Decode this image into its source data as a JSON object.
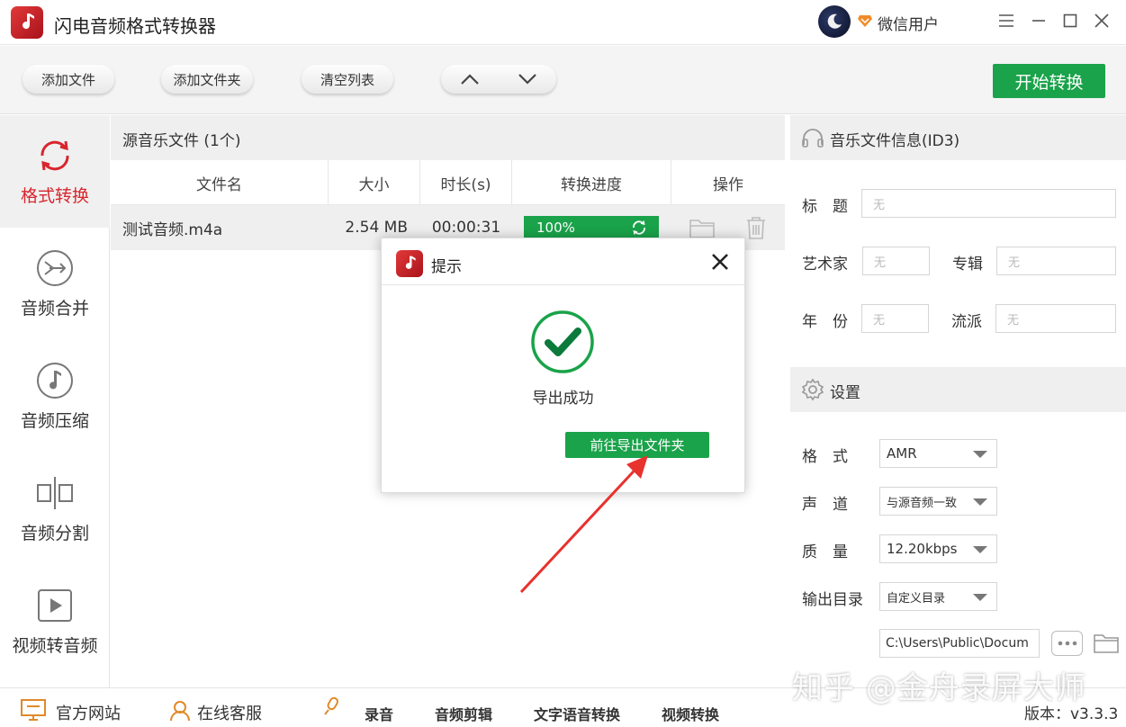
{
  "app": {
    "title": "闪电音频格式转换器",
    "user_name": "微信用户"
  },
  "toolbar": {
    "add_file": "添加文件",
    "add_folder": "添加文件夹",
    "clear_list": "清空列表",
    "start": "开始转换"
  },
  "sidebar": {
    "items": [
      {
        "label": "格式转换",
        "icon": "refresh-icon",
        "active": true
      },
      {
        "label": "音频合并",
        "icon": "merge-icon",
        "active": false
      },
      {
        "label": "音频压缩",
        "icon": "music-note-icon",
        "active": false
      },
      {
        "label": "音频分割",
        "icon": "split-icon",
        "active": false
      },
      {
        "label": "视频转音频",
        "icon": "play-icon",
        "active": false
      }
    ]
  },
  "file_list": {
    "header": "源音乐文件 (1个)",
    "columns": [
      "文件名",
      "大小",
      "时长(s)",
      "转换进度",
      "操作"
    ],
    "rows": [
      {
        "name": "测试音频.m4a",
        "size": "2.54 MB",
        "duration": "00:00:31",
        "progress": "100%"
      }
    ]
  },
  "id3": {
    "title": "音乐文件信息(ID3)",
    "title_label": "标　题",
    "artist_label": "艺术家",
    "album_label": "专辑",
    "year_label": "年　份",
    "genre_label": "流派",
    "placeholder": "无"
  },
  "settings": {
    "title": "设置",
    "format_label": "格　式",
    "format_value": "AMR",
    "channel_label": "声　道",
    "channel_value": "与源音频一致",
    "quality_label": "质　量",
    "quality_value": "12.20kbps",
    "output_label": "输出目录",
    "output_value": "自定义目录",
    "path": "C:\\Users\\Public\\Docum"
  },
  "footer": {
    "website": "官方网站",
    "support": "在线客服",
    "record": "录音",
    "audio_edit": "音频剪辑",
    "tts": "文字语音转换",
    "video_convert": "视频转换",
    "version": "版本：v3.3.3"
  },
  "dialog": {
    "title": "提示",
    "message": "导出成功",
    "button": "前往导出文件夹"
  },
  "watermark": "知乎 @金舟录屏大师",
  "colors": {
    "brand_red": "#d8262e",
    "green": "#1aa34a"
  }
}
